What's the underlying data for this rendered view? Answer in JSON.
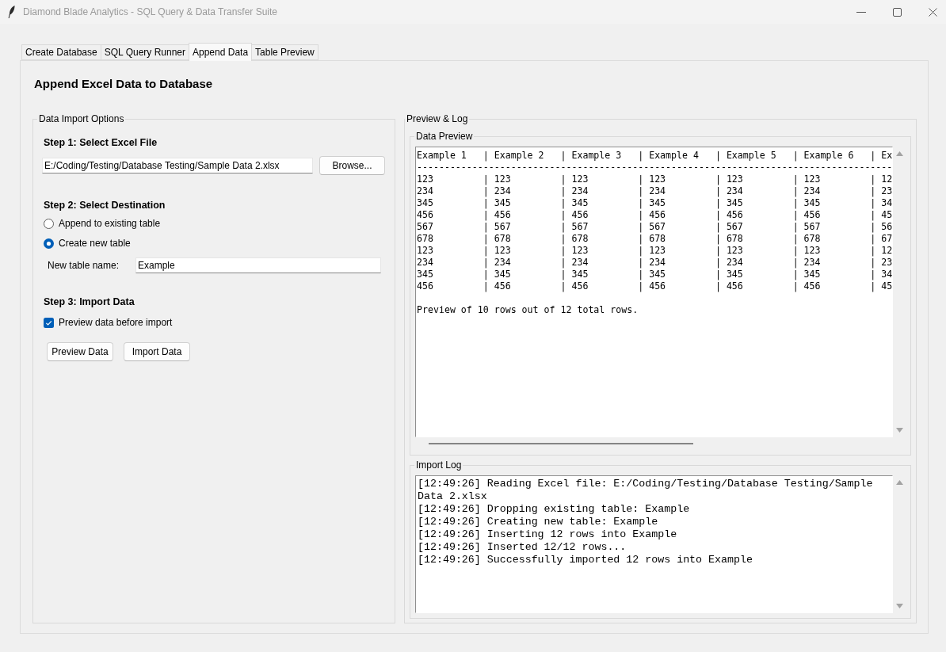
{
  "window": {
    "title": "Diamond Blade Analytics - SQL Query & Data Transfer Suite"
  },
  "tabs": [
    {
      "label": "Create Database",
      "selected": false
    },
    {
      "label": "SQL Query Runner",
      "selected": false
    },
    {
      "label": "Append Data",
      "selected": true
    },
    {
      "label": "Table Preview",
      "selected": false
    }
  ],
  "heading": "Append Excel Data to Database",
  "import_options": {
    "title": "Data Import Options",
    "step1": {
      "heading": "Step 1: Select Excel File",
      "file_path": "E:/Coding/Testing/Database Testing/Sample Data 2.xlsx",
      "browse_button": "Browse..."
    },
    "step2": {
      "heading": "Step 2: Select Destination",
      "options": [
        {
          "label": "Append to existing table",
          "selected": false
        },
        {
          "label": "Create new table",
          "selected": true
        }
      ],
      "table_name_label": "New table name:",
      "table_name": "Example"
    },
    "step3": {
      "heading": "Step 3: Import Data",
      "preview_checkbox": {
        "label": "Preview data before import",
        "checked": true
      },
      "buttons": [
        "Preview Data",
        "Import Data"
      ]
    }
  },
  "preview_log": {
    "title": "Preview & Log",
    "data_preview": {
      "title": "Data Preview",
      "lines": [
        "Example 1   | Example 2   | Example 3   | Example 4   | Example 5   | Example 6   | Ex",
        "--------------------------------------------------------------------------------------",
        "123         | 123         | 123         | 123         | 123         | 123         | 12",
        "234         | 234         | 234         | 234         | 234         | 234         | 23",
        "345         | 345         | 345         | 345         | 345         | 345         | 34",
        "456         | 456         | 456         | 456         | 456         | 456         | 45",
        "567         | 567         | 567         | 567         | 567         | 567         | 56",
        "678         | 678         | 678         | 678         | 678         | 678         | 67",
        "123         | 123         | 123         | 123         | 123         | 123         | 12",
        "234         | 234         | 234         | 234         | 234         | 234         | 23",
        "345         | 345         | 345         | 345         | 345         | 345         | 34",
        "456         | 456         | 456         | 456         | 456         | 456         | 45"
      ],
      "summary": "Preview of 10 rows out of 12 total rows."
    },
    "import_log": {
      "title": "Import Log",
      "lines": [
        "[12:49:26] Reading Excel file: E:/Coding/Testing/Database Testing/Sample Data 2.xlsx",
        "[12:49:26] Dropping existing table: Example",
        "[12:49:26] Creating new table: Example",
        "[12:49:26] Inserting 12 rows into Example",
        "[12:49:26] Inserted 12/12 rows...",
        "[12:49:26] Successfully imported 12 rows into Example"
      ]
    }
  }
}
